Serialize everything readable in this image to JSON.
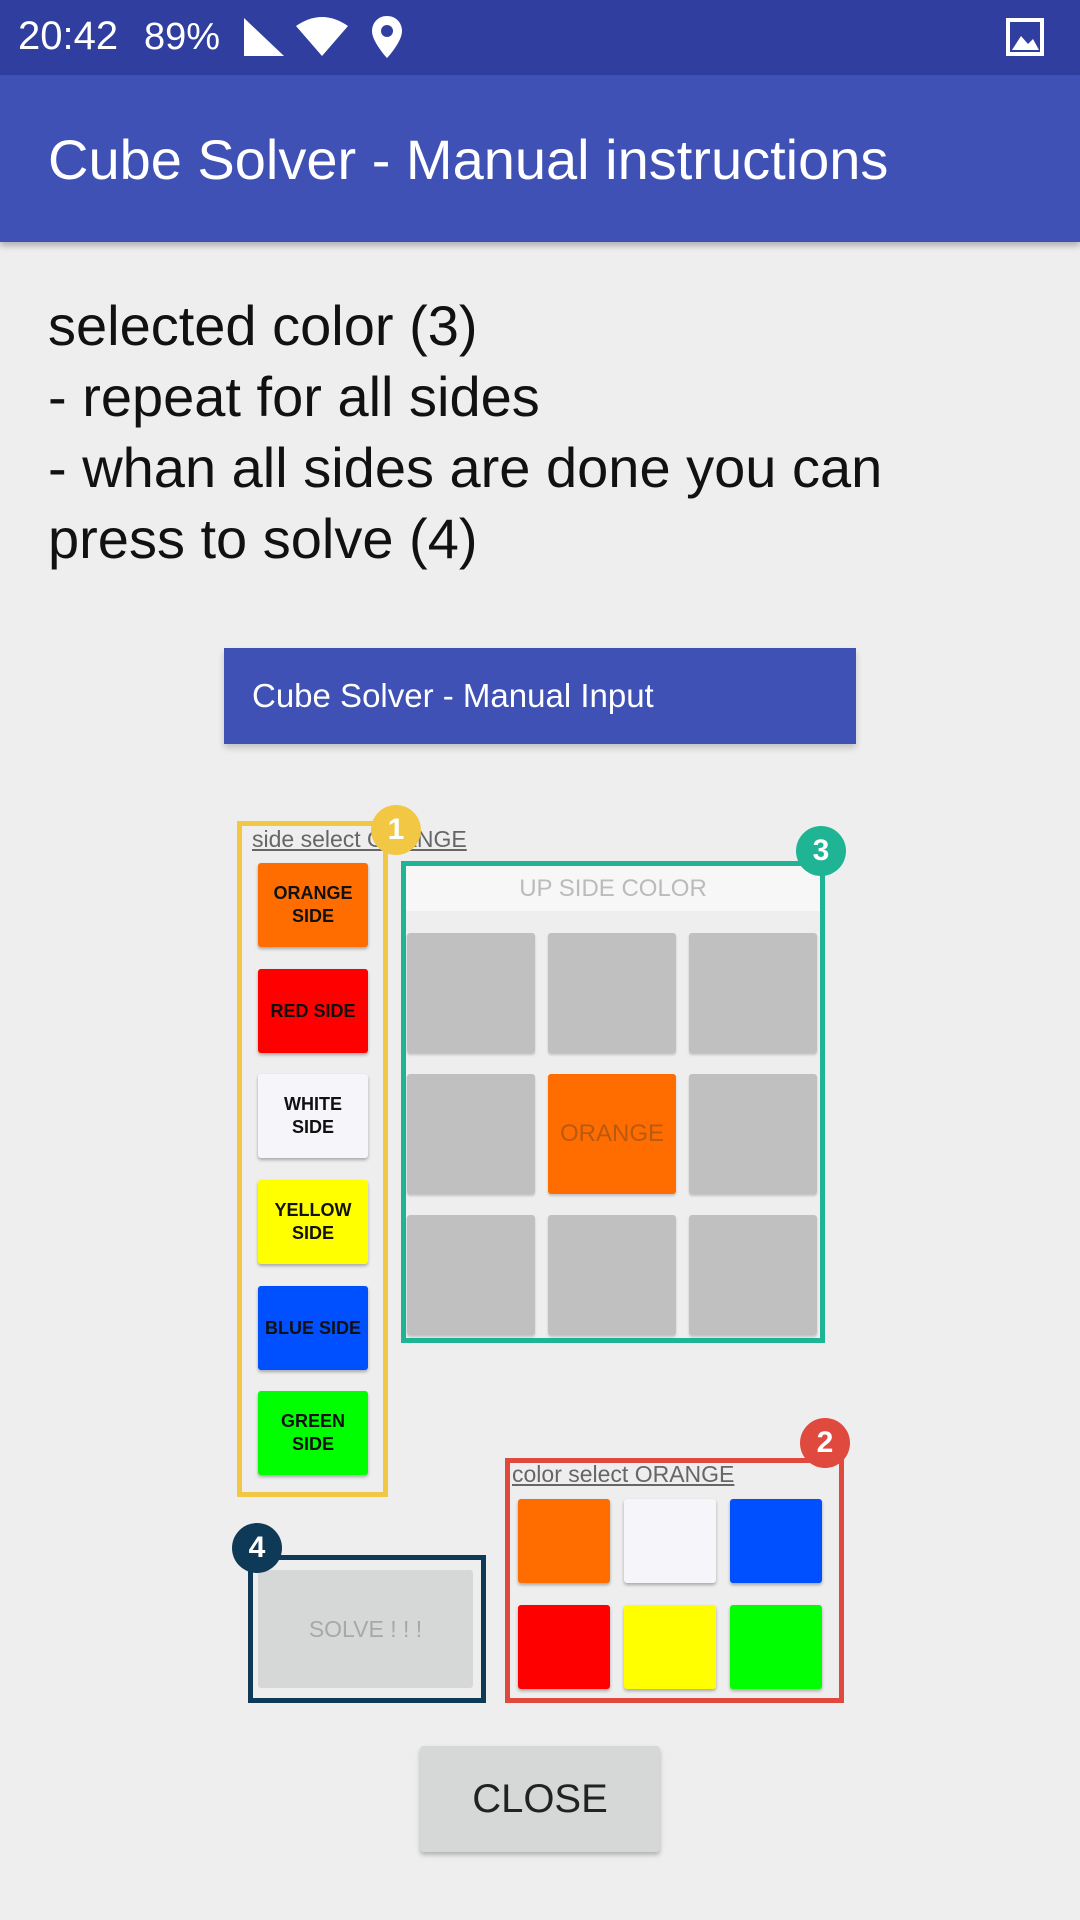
{
  "status_bar": {
    "time": "20:42",
    "battery": "89%"
  },
  "app_bar": {
    "title": "Cube Solver - Manual instructions"
  },
  "instructions": {
    "lines": [
      "selected color (3)",
      "- repeat for all sides",
      "- whan all sides are done you can",
      "press to solve (4)"
    ]
  },
  "embedded": {
    "title": "Cube Solver - Manual Input",
    "side_select_label": "side select ORANGE",
    "side_buttons": [
      {
        "label": "ORANGE SIDE",
        "color": "#ff6d00"
      },
      {
        "label": "RED SIDE",
        "color": "#ff0000"
      },
      {
        "label": "WHITE SIDE",
        "color": "#f5f5fa"
      },
      {
        "label": "YELLOW SIDE",
        "color": "#ffff00"
      },
      {
        "label": "BLUE SIDE",
        "color": "#0050ff"
      },
      {
        "label": "GREEN SIDE",
        "color": "#00ff00"
      }
    ],
    "up_side_header": "UP SIDE COLOR",
    "grid_center_label": "ORANGE",
    "grid_center_color": "#ff6d00",
    "grid_empty_color": "#c0c0c0",
    "color_select_label": "color select ORANGE",
    "palette": [
      "#ff6d00",
      "#f5f5fa",
      "#0050ff",
      "#ff0000",
      "#ffff00",
      "#00ff00"
    ],
    "solve_label": "SOLVE ! ! !",
    "badges": [
      "1",
      "2",
      "3",
      "4"
    ],
    "highlight_colors": {
      "side_select": "#f2c744",
      "color_select": "#e0493e",
      "grid": "#1eb494",
      "solve": "#0f3a57"
    }
  },
  "close_button": {
    "label": "CLOSE"
  }
}
